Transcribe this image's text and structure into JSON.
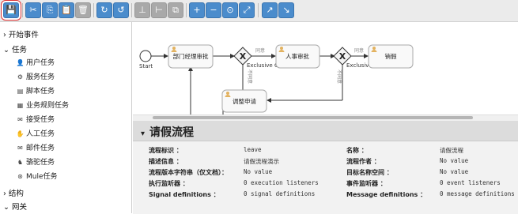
{
  "toolbar": {
    "buttons": [
      {
        "icon": "save-icon",
        "glyph": "💾"
      },
      {
        "icon": "cut-icon",
        "glyph": "✂"
      },
      {
        "icon": "copy-icon",
        "glyph": "⎘"
      },
      {
        "icon": "paste-icon",
        "glyph": "📋"
      },
      {
        "icon": "delete-icon",
        "glyph": "🗑"
      },
      {
        "icon": "redo-icon",
        "glyph": "↻"
      },
      {
        "icon": "undo-icon",
        "glyph": "↺"
      },
      {
        "icon": "align-horizontal-icon",
        "glyph": "⊥"
      },
      {
        "icon": "align-vertical-icon",
        "glyph": "⊢"
      },
      {
        "icon": "same-size-icon",
        "glyph": "⧉"
      },
      {
        "icon": "zoom-in-icon",
        "glyph": "+"
      },
      {
        "icon": "zoom-out-icon",
        "glyph": "−"
      },
      {
        "icon": "zoom-actual-icon",
        "glyph": "⊙"
      },
      {
        "icon": "zoom-fit-icon",
        "glyph": "⤢"
      },
      {
        "icon": "add-bendpoint-icon",
        "glyph": "↗"
      },
      {
        "icon": "remove-bendpoint-icon",
        "glyph": "↘"
      }
    ]
  },
  "sidebar": {
    "start_events": "开始事件",
    "tasks": "任务",
    "task_items": [
      {
        "label": "用户任务",
        "icon": "user-icon",
        "glyph": "👤"
      },
      {
        "label": "服务任务",
        "icon": "gear-icon",
        "glyph": "⚙"
      },
      {
        "label": "脚本任务",
        "icon": "script-icon",
        "glyph": "▤"
      },
      {
        "label": "业务规则任务",
        "icon": "table-icon",
        "glyph": "▦"
      },
      {
        "label": "接受任务",
        "icon": "envelope-icon",
        "glyph": "✉"
      },
      {
        "label": "人工任务",
        "icon": "hand-icon",
        "glyph": "✋"
      },
      {
        "label": "邮件任务",
        "icon": "mail-icon",
        "glyph": "✉"
      },
      {
        "label": "骆驼任务",
        "icon": "camel-icon",
        "glyph": "♞"
      },
      {
        "label": "Mule任务",
        "icon": "mule-icon",
        "glyph": "⊛"
      }
    ],
    "structure": "结构",
    "gateways": "网关"
  },
  "canvas": {
    "start_label": "Start",
    "tasks": [
      "部门经理审批",
      "人事审批",
      "销假",
      "调整申请"
    ],
    "gateway_labels": [
      "Exclusive Gat",
      "Exclusive G"
    ],
    "flow_labels": [
      "同意",
      "同意",
      "不同意",
      "不同意"
    ]
  },
  "properties": {
    "title": "请假流程",
    "rows": [
      {
        "label1": "流程标识 ：",
        "value1": "leave",
        "label2": "名称 ：",
        "value2": "请假流程"
      },
      {
        "label1": "描述信息 ：",
        "value1": "请假流程演示",
        "label2": "流程作者 ：",
        "value2": "No value"
      },
      {
        "label1": "流程版本字符串（仅文档）：",
        "value1": "No value",
        "label2": "目标名称空间 ：",
        "value2": "No value"
      },
      {
        "label1": "执行监听器 ：",
        "value1": "0 execution listeners",
        "label2": "事件监听器 ：",
        "value2": "0 event listeners"
      },
      {
        "label1": "Signal definitions ：",
        "value1": "0 signal definitions",
        "label2": "Message definitions ：",
        "value2": "0 message definitions"
      }
    ]
  },
  "colors": {
    "accent": "#4b8ccc",
    "task_fill": "#f9f9f9",
    "task_stroke": "#aaaaaa",
    "user_icon": "#e3b25f"
  }
}
